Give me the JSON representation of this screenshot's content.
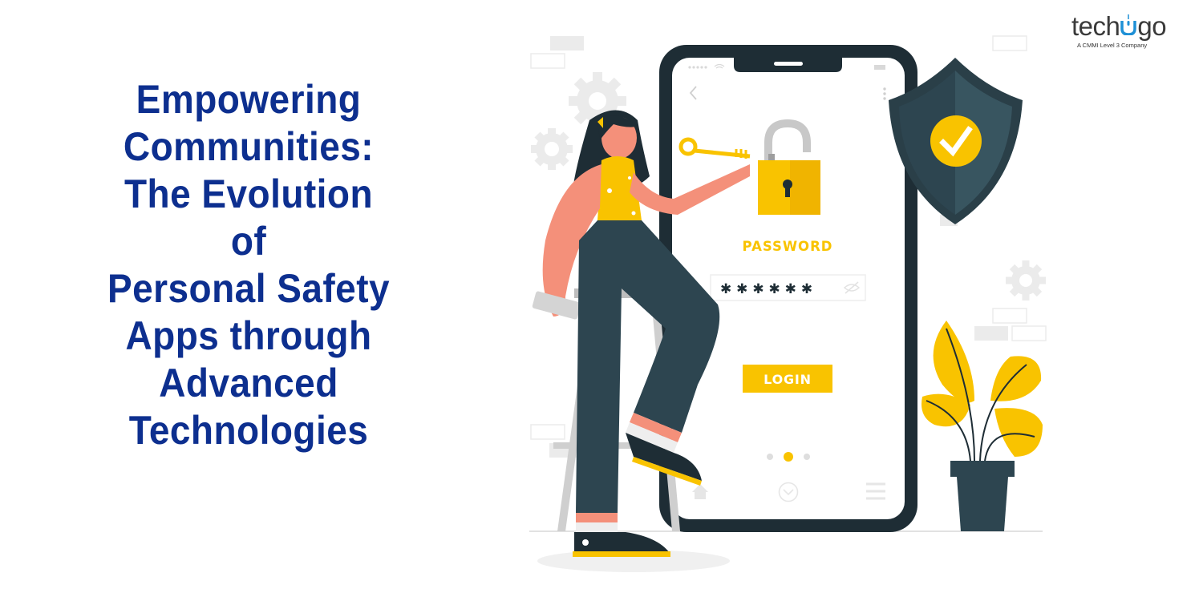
{
  "headline": {
    "lines": [
      "Empowering",
      "Communities:",
      "The Evolution",
      "of",
      "Personal Safety",
      "Apps through",
      "Advanced",
      "Technologies"
    ],
    "color": "#0d2f8f"
  },
  "logo": {
    "word_left": "tech",
    "word_right": "go",
    "tagline": "A CMMI  Level 3 Company",
    "accent": "#1e90d6"
  },
  "illustration": {
    "phone": {
      "password_label": "PASSWORD",
      "password_mask": "✱ ✱ ✱ ✱ ✱ ✱",
      "login_label": "LOGIN",
      "page_dots": 3,
      "active_dot": 2
    },
    "colors": {
      "yellow": "#f9c300",
      "dark": "#1e2d35",
      "slate": "#2d4550",
      "skin": "#f4907a",
      "gray": "#e6e6e6"
    }
  }
}
